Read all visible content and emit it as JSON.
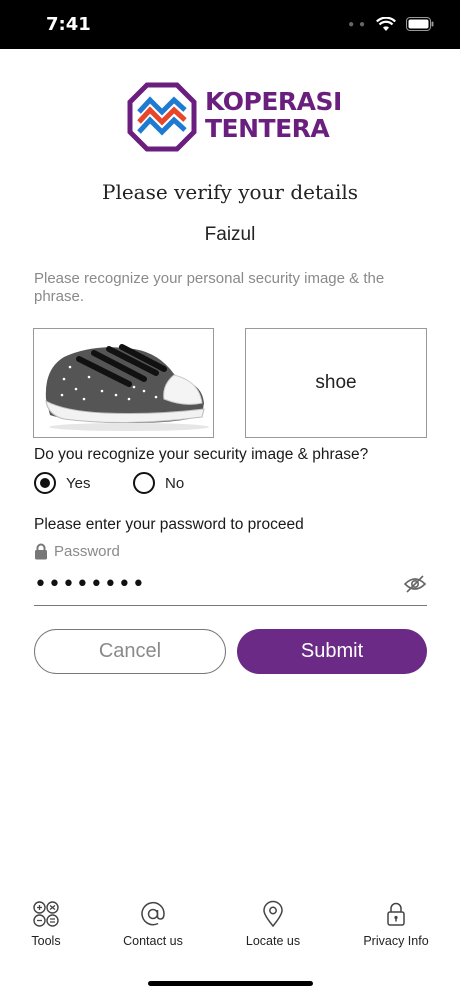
{
  "status_bar": {
    "time": "7:41"
  },
  "brand": {
    "line1": "KOPERASI",
    "line2": "TENTERA",
    "color": "#6a1f7f"
  },
  "verify": {
    "title": "Please verify your details",
    "user_name": "Faizul",
    "instruction": "Please recognize your personal security image & the phrase."
  },
  "security": {
    "image_icon": "sneaker-image",
    "phrase": "shoe",
    "question": "Do you recognize your security image & phrase?",
    "options": [
      {
        "label": "Yes",
        "selected": true
      },
      {
        "label": "No",
        "selected": false
      }
    ]
  },
  "password": {
    "prompt": "Please enter your password to proceed",
    "label": "Password",
    "value": "••••••••"
  },
  "buttons": {
    "cancel": "Cancel",
    "submit": "Submit",
    "submit_color": "#6b2a85"
  },
  "tabbar": {
    "items": [
      {
        "label": "Tools",
        "icon": "calculator-icon"
      },
      {
        "label": "Contact us",
        "icon": "at-icon"
      },
      {
        "label": "Locate us",
        "icon": "map-pin-icon"
      },
      {
        "label": "Privacy Info",
        "icon": "lock-icon"
      }
    ]
  }
}
